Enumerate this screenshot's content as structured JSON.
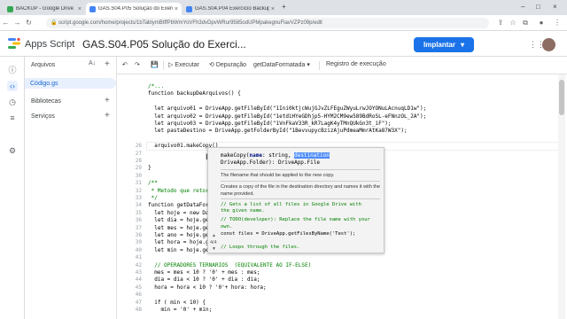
{
  "browser": {
    "tabs": [
      {
        "label": "BACKUP - Google Drive",
        "color": "#34a853"
      },
      {
        "label": "GAS.S04.P05 Solução do Exercício",
        "color": "#4285f4"
      },
      {
        "label": "GAS.S04.P04 Exercício Backup do D...",
        "color": "#4285f4"
      }
    ],
    "new_tab": "+",
    "url": "script.google.com/home/projects/1bTablymBtffPbWmYoVFh3dvDpvWRur9585odUPMpakegnuFlavVZPz09p/edit"
  },
  "app": {
    "name": "Apps Script",
    "project_title": "GAS.S04.P05 Solução do Exerci...",
    "deploy_label": "Implantar",
    "deploy_caret": "▾"
  },
  "sidebar": {
    "files_label": "Arquivos",
    "file": "Código.gs",
    "libraries_label": "Bibliotecas",
    "services_label": "Serviços"
  },
  "toolbar": {
    "run_label": "Executar",
    "debug_label": "Depuração",
    "function_select": "getDataFormatada",
    "log_label": "Registro de execução"
  },
  "editor": {
    "line_numbers": [
      "",
      "",
      "",
      "",
      "",
      "",
      "",
      "",
      "26",
      "27",
      "28",
      "29",
      "30",
      "31",
      "32",
      "33",
      "34",
      "35",
      "36",
      "37",
      "38",
      "39",
      "40",
      "41",
      "42",
      "43",
      "44",
      "45",
      "46",
      "47",
      "48",
      "49",
      "50",
      "51",
      "52"
    ],
    "lines": [
      "/*...",
      "function backupDeArquivos() {",
      "",
      "  let arquivo01 = DriveApp.getFileById(\"1Ini0ktjcWujGJvZLFEguZWyuLrwJOYONuLAcnuqLD1w\");",
      "  let arquivo02 = DriveApp.getFileById(\"1etdiHYeGDhjp5-HYM2CM9ew589BdRoSL-eFNnzOL_2A\");",
      "  let arquivo03 = DriveApp.getFileById(\"1VnFkaV33R_kR7LagK4yTMnQUkGn3t_iF\");",
      "  let pastaDestino = DriveApp.getFolderById(\"1BevvupycBzizAjuPdmeaMmrAtKa87W3X\");",
      "",
      "  arquivo01.makeCopy()",
      "",
      "",
      "}",
      "",
      "/**",
      " * Metodo que retorna...",
      " */",
      "function getDataForma...",
      "  let hoje = new Date...",
      "  let dia = hoje.getD...",
      "  let mes = hoje.getM...",
      "  let ano = hoje.getF...",
      "  let hora = hoje.get...",
      "  let min = hoje.getMinutes();",
      "",
      "  // OPERADORES TERNARIOS  (EQUIVALENTE AO IF-ELSE)",
      "  mes = mes < 10 ? '0' + mes : mes;",
      "  dia = dia < 10 ? '0' + dia : dia;",
      "  hora = hora < 10 ? '0'+ hora: hora;",
      "",
      "  if ( min < 10) {",
      "    min = '0' + min;"
    ]
  },
  "popup": {
    "signature_1a": "makeCopy(",
    "signature_name": "name",
    "signature_1b": ": string, ",
    "signature_hl": "destination",
    "signature_2": "DriveApp.Folder): DriveApp.File",
    "param_doc": "The filename that should be applied to the new copy.",
    "doc": "Creates a copy of the file in the destination directory and names it with the name provided.",
    "code_1": "// Gets a list of all files in Google Drive with",
    "code_2": "the given name.",
    "code_3": "// TODO(developer): Replace the file name with your",
    "code_4": "own.",
    "code_5": "const files = DriveApp.getFilesByName('Test');",
    "code_6": "// Loops through the files.",
    "counter": "4/4"
  }
}
